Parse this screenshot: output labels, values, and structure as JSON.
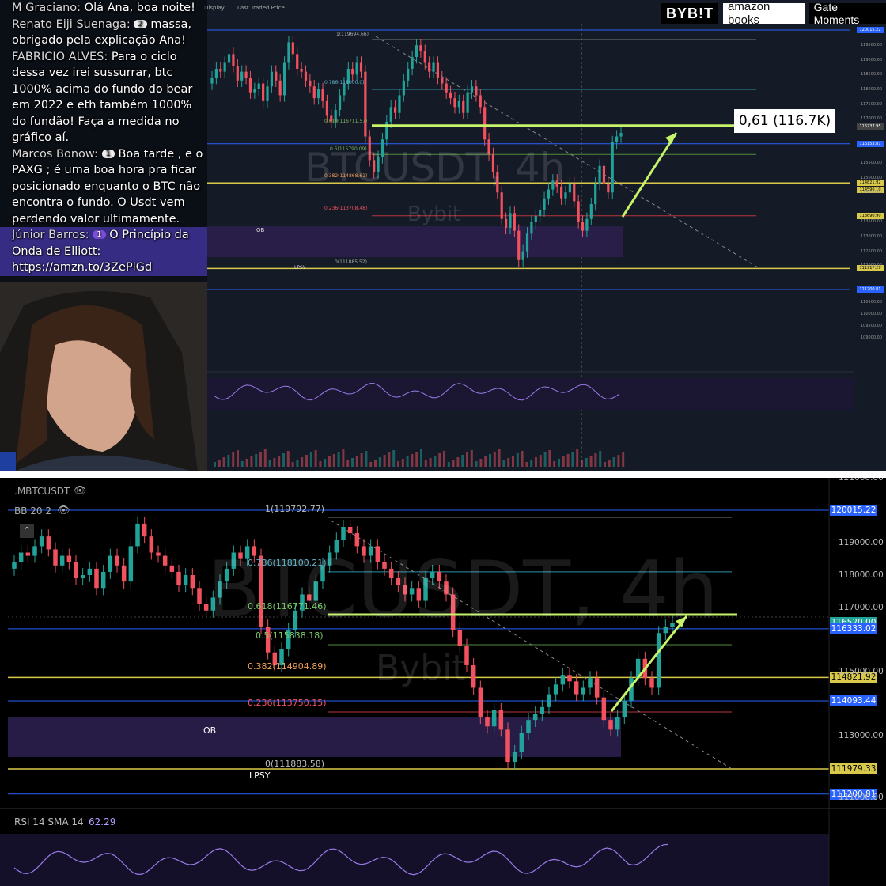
{
  "sponsors": {
    "bybit": "BYB!T",
    "amazon": "amazon books",
    "gate": "Gate Moments"
  },
  "chat": {
    "messages": [
      {
        "author": "M Graciano:",
        "text": "Olá Ana, boa noite!",
        "badge": ""
      },
      {
        "author": "Renato Eiji Suenaga:",
        "text": "massa, obrigado pela explicação Ana!",
        "badge": "2"
      },
      {
        "author": "FABRICIO ALVES:",
        "text": "Para o ciclo dessa vez irei sussurrar, btc 1000% acima do fundo do bear em 2022 e eth também 1000% do fundão! Faça a medida no gráfico aí.",
        "badge": ""
      },
      {
        "author": "Marcos Bonow:",
        "text": "Boa tarde , e o PAXG ; é uma boa hora pra ficar posicionado enquanto o BTC não encontra o fundo. O Usdt vem perdendo valor ultimamente.",
        "badge": "1"
      },
      {
        "author": "Júnior Barros:",
        "text": "O Princípio da Onda de Elliott: https://amzn.to/3ZePlGd",
        "badge": "1"
      }
    ]
  },
  "top_chart": {
    "toolbar": [
      "Display",
      "Last Traded Price"
    ],
    "watermark": "BTCUSDT, 4h",
    "watermark_sub": "Bybit",
    "annotation": "0,61 (116.7K)",
    "fib_labels": [
      "1(119694.66)",
      "0.786(118000.0)",
      "0.618(116711.57)",
      "0.5(115790.09)",
      "0.382(114868.61)",
      "0.236(113708.48)",
      "0(111885.52)"
    ],
    "ob_label": "OB",
    "lpsy_label": "LPSY",
    "axis_labels": [
      "120015.22",
      "116737.95",
      "116153.81",
      "114821.92",
      "114590.10",
      "113690.90",
      "111917.29",
      "111200.81"
    ],
    "axis_ticks": [
      "119500.00",
      "119000.00",
      "118500.00",
      "118000.00",
      "117500.00",
      "117000.00",
      "115500.00",
      "115000.00",
      "114500.00",
      "113500.00",
      "113000.00",
      "112500.00",
      "112000.00",
      "110500.00",
      "110000.00",
      "109500.00",
      "109000.00"
    ]
  },
  "bottom_chart": {
    "symbol": ".MBTCUSDT",
    "indicator": "BB 20 2",
    "watermark": "BTCUSDT, 4h",
    "watermark_sub": "Bybit",
    "fib_labels": [
      "1(119792.77)",
      "0.786(118100.21)",
      "0.618(116771.46)",
      "0.5(115838.18)",
      "0.382(114904.89)",
      "0.236(113750.15)",
      "0(111883.58)"
    ],
    "ob_label": "OB",
    "lpsy_label": "LPSY",
    "rsi_label": "RSI 14 SMA 14",
    "rsi_value": "62.29",
    "axis_labels": [
      "120015.22",
      "116520.00",
      "116333.02",
      "114821.92",
      "114093.44",
      "111979.33",
      "111200.81"
    ],
    "axis_ticks": [
      "121000.00",
      "119000.00",
      "118000.00",
      "117000.00",
      "115000.00",
      "113000.00",
      "111000.00"
    ],
    "colors": {
      "up": "#22a39a",
      "down": "#f2515f",
      "fib_green": "#c6f36a",
      "blue_line": "#2962ff",
      "yellow_line": "#d9c94a"
    }
  },
  "chart_data": {
    "type": "candlestick",
    "title": "BTCUSDT, 4h",
    "xlabel": "",
    "ylabel": "",
    "ylim": [
      111000,
      121000
    ],
    "fib_levels": [
      {
        "level": "1",
        "value": 119792.77
      },
      {
        "level": "0.786",
        "value": 118100.21
      },
      {
        "level": "0.618",
        "value": 116771.46
      },
      {
        "level": "0.5",
        "value": 115838.18
      },
      {
        "level": "0.382",
        "value": 114904.89
      },
      {
        "level": "0.236",
        "value": 113750.15
      },
      {
        "level": "0",
        "value": 111883.58
      }
    ],
    "close_series": [
      118400,
      118700,
      118600,
      118900,
      119200,
      118800,
      118300,
      118600,
      118400,
      117900,
      118000,
      118200,
      117600,
      118100,
      118600,
      118300,
      117800,
      118900,
      119600,
      119200,
      118700,
      118600,
      118300,
      118100,
      117700,
      118000,
      117600,
      117100,
      116900,
      117300,
      117800,
      118200,
      118700,
      118500,
      118900,
      118600,
      116400,
      115600,
      115200,
      115700,
      116300,
      116900,
      117400,
      117200,
      117800,
      118300,
      118700,
      119100,
      119500,
      119300,
      118900,
      118600,
      118900,
      118400,
      118200,
      117900,
      117700,
      117400,
      117600,
      117200,
      117900,
      118100,
      117800,
      117400,
      116300,
      115800,
      115200,
      114500,
      113600,
      113300,
      113800,
      113200,
      112200,
      112500,
      113100,
      113500,
      113700,
      113900,
      114300,
      114600,
      114900,
      114700,
      114300,
      114500,
      114800,
      114200,
      113500,
      113200,
      113600,
      114100,
      114800,
      115400,
      114800,
      114500,
      116200,
      116400,
      116520
    ]
  }
}
